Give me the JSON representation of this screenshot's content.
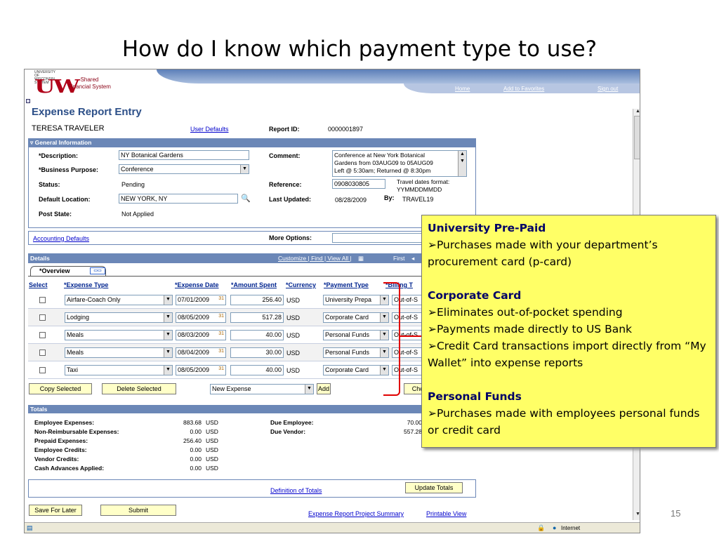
{
  "slide": {
    "title": "How do I know which payment type to use?",
    "page_number": "15"
  },
  "header": {
    "logo_small": "UNIVERSITY OF WISCONSIN SYSTEM",
    "logo_uw": "UW",
    "logo_line1": "Shared",
    "logo_line2": "Financial System",
    "nav": [
      "Home",
      "Add to Favorites",
      "Sign out"
    ]
  },
  "page": {
    "title": "Expense Report Entry",
    "employee": "TERESA TRAVELER",
    "user_defaults": "User Defaults",
    "report_id_label": "Report ID:",
    "report_id": "0000001897"
  },
  "general": {
    "section_title": "General Information",
    "description_label": "*Description:",
    "description": "NY Botanical Gardens",
    "purpose_label": "*Business Purpose:",
    "purpose": "Conference",
    "status_label": "Status:",
    "status": "Pending",
    "location_label": "Default Location:",
    "location": "NEW YORK, NY",
    "post_state_label": "Post State:",
    "post_state": "Not Applied",
    "comment_label": "Comment:",
    "comment_lines": [
      "Conference at New York Botanical",
      "Gardens from 03AUG09 to 05AUG09",
      "Left @ 5:30am; Returned @ 8:30pm"
    ],
    "reference_label": "Reference:",
    "reference": "0908030805",
    "reference_hint_1": "Travel dates format:",
    "reference_hint_2": "YYMMDDMMDD",
    "last_updated_label": "Last Updated:",
    "last_updated": "08/28/2009",
    "by_label": "By:",
    "by": "TRAVEL19"
  },
  "accounting": {
    "link": "Accounting Defaults",
    "more_options_label": "More Options:"
  },
  "details": {
    "title": "Details",
    "links": "Customize | Find | View All |",
    "first": "First",
    "tab": "*Overview",
    "columns": [
      "Select",
      "*Expense Type",
      "*Expense Date",
      "*Amount Spent",
      "*Currency",
      "*Payment Type",
      "*Billing T"
    ],
    "rows": [
      {
        "type": "Airfare-Coach Only",
        "date": "07/01/2009",
        "amount": "256.40",
        "currency": "USD",
        "payment": "University Prepa",
        "billing": "Out-of-S"
      },
      {
        "type": "Lodging",
        "date": "08/05/2009",
        "amount": "517.28",
        "currency": "USD",
        "payment": "Corporate Card",
        "billing": "Out-of-S"
      },
      {
        "type": "Meals",
        "date": "08/03/2009",
        "amount": "40.00",
        "currency": "USD",
        "payment": "Personal Funds",
        "billing": "Out-of-S"
      },
      {
        "type": "Meals",
        "date": "08/04/2009",
        "amount": "30.00",
        "currency": "USD",
        "payment": "Personal Funds",
        "billing": "Out-of-S"
      },
      {
        "type": "Taxi",
        "date": "08/05/2009",
        "amount": "40.00",
        "currency": "USD",
        "payment": "Corporate Card",
        "billing": "Out-of-S"
      }
    ],
    "copy_selected": "Copy Selected",
    "delete_selected": "Delete Selected",
    "new_expense": "New Expense",
    "add": "Add",
    "check": "Che"
  },
  "totals": {
    "title": "Totals",
    "left": [
      {
        "label": "Employee Expenses:",
        "value": "883.68",
        "unit": "USD"
      },
      {
        "label": "Non-Reimbursable Expenses:",
        "value": "0.00",
        "unit": "USD"
      },
      {
        "label": "Prepaid Expenses:",
        "value": "256.40",
        "unit": "USD"
      },
      {
        "label": "Employee Credits:",
        "value": "0.00",
        "unit": "USD"
      },
      {
        "label": "Vendor Credits:",
        "value": "0.00",
        "unit": "USD"
      },
      {
        "label": "Cash Advances Applied:",
        "value": "0.00",
        "unit": "USD"
      }
    ],
    "due_employee_label": "Due Employee:",
    "due_employee": "70.00",
    "due_vendor_label": "Due Vendor:",
    "due_vendor": "557.28",
    "definition_link": "Definition of Totals",
    "update_totals": "Update Totals"
  },
  "footer": {
    "save_for_later": "Save For Later",
    "submit": "Submit",
    "project_summary": "Expense Report Project Summary",
    "printable_view": "Printable View"
  },
  "statusbar": {
    "zone": "Internet"
  },
  "callout": {
    "h1": "University Pre-Paid",
    "p1": "➢Purchases made with your department’s procurement card (p-card)",
    "h2": "Corporate Card",
    "p2a": "➢Eliminates out-of-pocket spending",
    "p2b": "➢Payments made directly to US Bank",
    "p2c": "➢Credit Card transactions import directly from “My Wallet” into expense reports",
    "h3": "Personal Funds",
    "p3": "➢Purchases made with employees personal funds or credit card"
  },
  "colors": {
    "section_bar": "#6b87b7",
    "callout": "#ffff66",
    "bracket": "#e00000",
    "title_blue": "#2c4f88",
    "uw_red": "#b00018"
  }
}
